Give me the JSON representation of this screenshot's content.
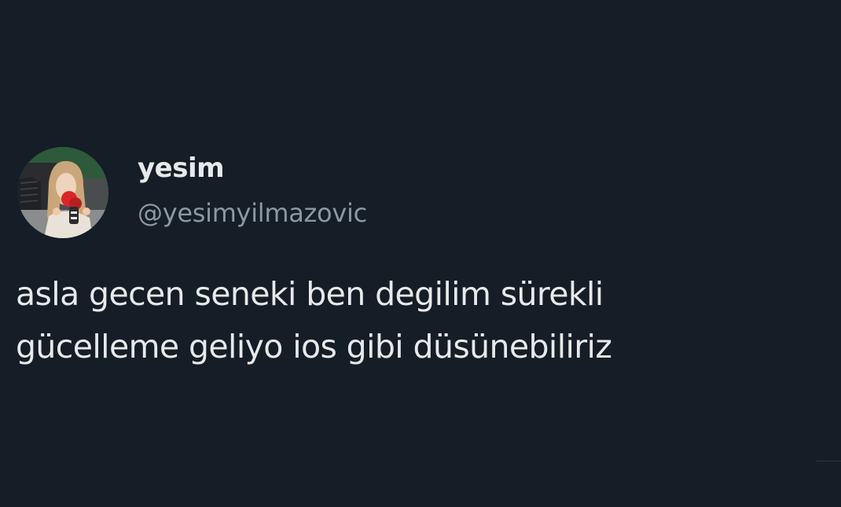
{
  "author": {
    "display_name": "yesim",
    "handle": "@yesimyilmazovic",
    "avatar_icon": "profile-photo"
  },
  "tweet": {
    "lines": [
      "asla gecen seneki ben degilim sürekli",
      "gücelleme geliyo ios gibi düsünebiliriz"
    ]
  },
  "colors": {
    "background": "#151d26",
    "primary_text": "#e7e9ea",
    "secondary_text": "#8b98a5"
  }
}
